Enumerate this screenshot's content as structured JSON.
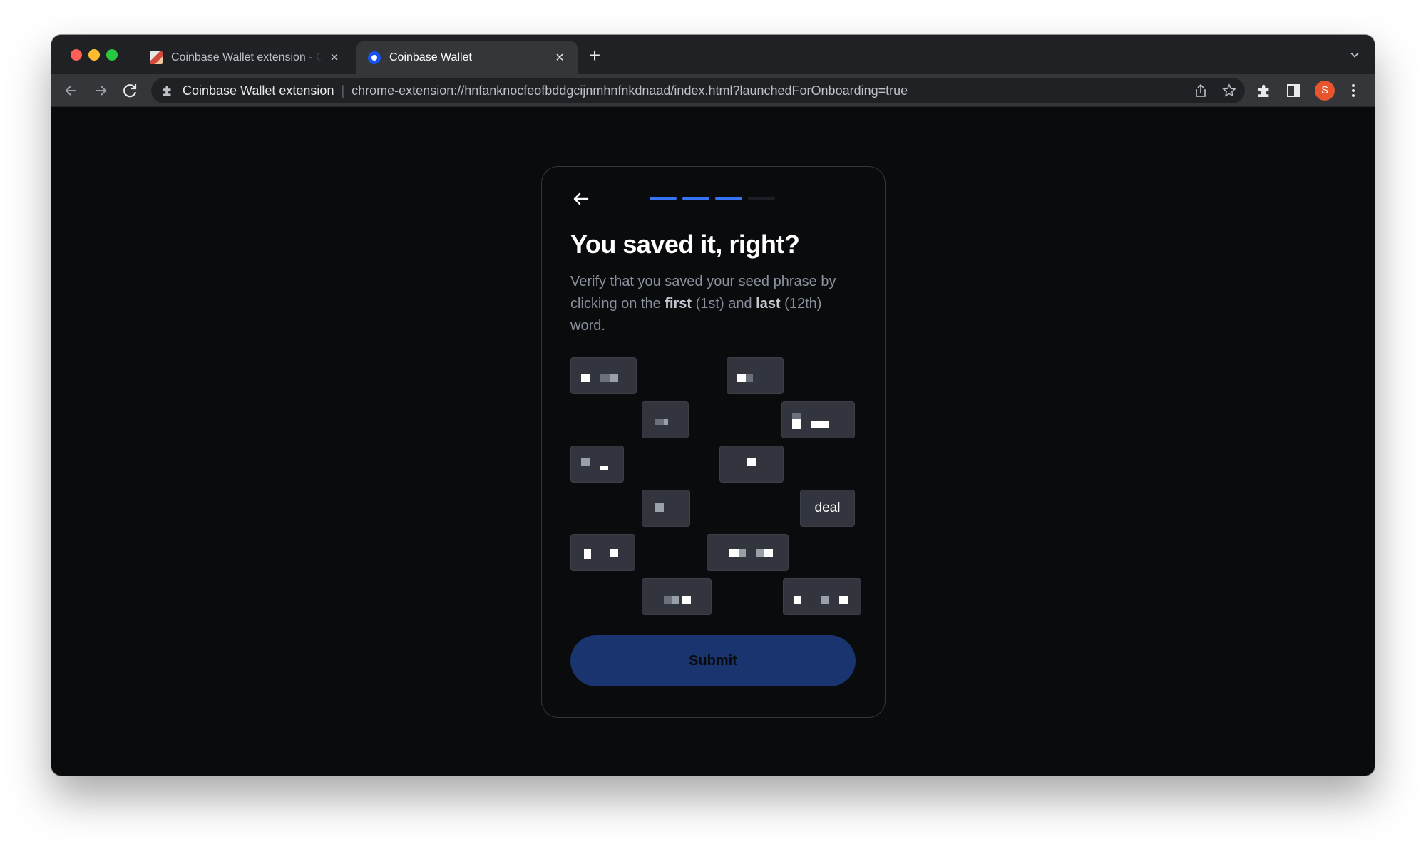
{
  "browser": {
    "tabs": [
      {
        "title": "Coinbase Wallet extension - Chrome Web Store",
        "active": false,
        "favicon": "coinbase-webstore-icon"
      },
      {
        "title": "Coinbase Wallet",
        "active": true,
        "favicon": "coinbase-wallet-icon"
      }
    ],
    "omnibox": {
      "origin": "Coinbase Wallet extension",
      "separator": "|",
      "url": "chrome-extension://hnfanknocfeofbddgcijnmhnfnkdnaad/index.html?launchedForOnboarding=true"
    },
    "profile_initial": "S",
    "profile_color": "#e8542b"
  },
  "onboarding": {
    "progress": {
      "total_steps": 4,
      "completed_steps": 3
    },
    "accent_color": "#3773f5",
    "title": "You saved it, right?",
    "description": {
      "part1": "Verify that you saved your seed phrase by clicking on the ",
      "first": "first",
      "part2": " (1st) and ",
      "last": "last",
      "part3": " (12th) word."
    },
    "words": [
      {
        "id": 1,
        "label": "",
        "redacted": true
      },
      {
        "id": 2,
        "label": "",
        "redacted": true
      },
      {
        "id": 3,
        "label": "",
        "redacted": true
      },
      {
        "id": 4,
        "label": "",
        "redacted": true
      },
      {
        "id": 5,
        "label": "",
        "redacted": true
      },
      {
        "id": 6,
        "label": "",
        "redacted": true
      },
      {
        "id": 7,
        "label": "",
        "redacted": true
      },
      {
        "id": 8,
        "label": "deal",
        "redacted": false
      },
      {
        "id": 9,
        "label": "",
        "redacted": true
      },
      {
        "id": 10,
        "label": "",
        "redacted": true
      },
      {
        "id": 11,
        "label": "",
        "redacted": true
      },
      {
        "id": 12,
        "label": "",
        "redacted": true
      }
    ],
    "submit_label": "Submit"
  }
}
